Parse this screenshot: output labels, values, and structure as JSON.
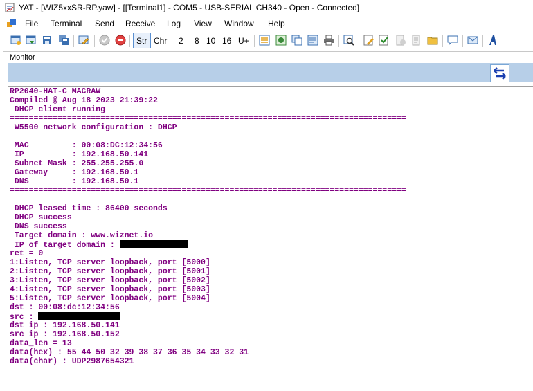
{
  "window": {
    "title": "YAT - [WIZ5xxSR-RP.yaw] - [[Terminal1] - COM5 - USB-SERIAL CH340 - Open - Connected]"
  },
  "menu": [
    "File",
    "Terminal",
    "Send",
    "Receive",
    "Log",
    "View",
    "Window",
    "Help"
  ],
  "toolbar": {
    "str": "Str",
    "chr": "Chr",
    "r2": "2",
    "r8": "8",
    "r10": "10",
    "r16": "16",
    "unicode": "U+"
  },
  "monitor": {
    "label": "Monitor"
  },
  "terminal": {
    "lines": [
      "RP2040-HAT-C MACRAW",
      "Compiled @ Aug 18 2023 21:39:22",
      " DHCP client running",
      "===================================================================================",
      " W5500 network configuration : DHCP",
      "",
      " MAC         : 00:08:DC:12:34:56",
      " IP          : 192.168.50.141",
      " Subnet Mask : 255.255.255.0",
      " Gateway     : 192.168.50.1",
      " DNS         : 192.168.50.1",
      "===================================================================================",
      "",
      " DHCP leased time : 86400 seconds",
      " DHCP success",
      " DNS success",
      " Target domain : www.wiznet.io",
      " IP of target domain : ",
      "ret = 0",
      "1:Listen, TCP server loopback, port [5000]",
      "2:Listen, TCP server loopback, port [5001]",
      "3:Listen, TCP server loopback, port [5002]",
      "4:Listen, TCP server loopback, port [5003]",
      "5:Listen, TCP server loopback, port [5004]",
      "dst : 00:08:dc:12:34:56",
      "src : ",
      "dst ip : 192.168.50.141",
      "src ip : 192.168.50.152",
      "data_len = 13",
      "data(hex) : 55 44 50 32 39 38 37 36 35 34 33 32 31",
      "data(char) : UDP2987654321"
    ]
  },
  "colors": {
    "terminal_text": "#800080",
    "bluebar": "#b7cfe8"
  },
  "icons": [
    "yat-app-icon",
    "new-terminal-icon",
    "open-icon",
    "save-icon",
    "save-all-icon",
    "terminal-settings-icon",
    "open-port-icon",
    "close-port-icon",
    "radix-settings-icon",
    "format-icon",
    "copy-icon",
    "print-icon",
    "find-icon",
    "edit-icon",
    "check-icon",
    "clear-icon",
    "log-icon",
    "log-folder-icon",
    "chat-icon",
    "send-icon",
    "font-icon",
    "swap-icon"
  ]
}
